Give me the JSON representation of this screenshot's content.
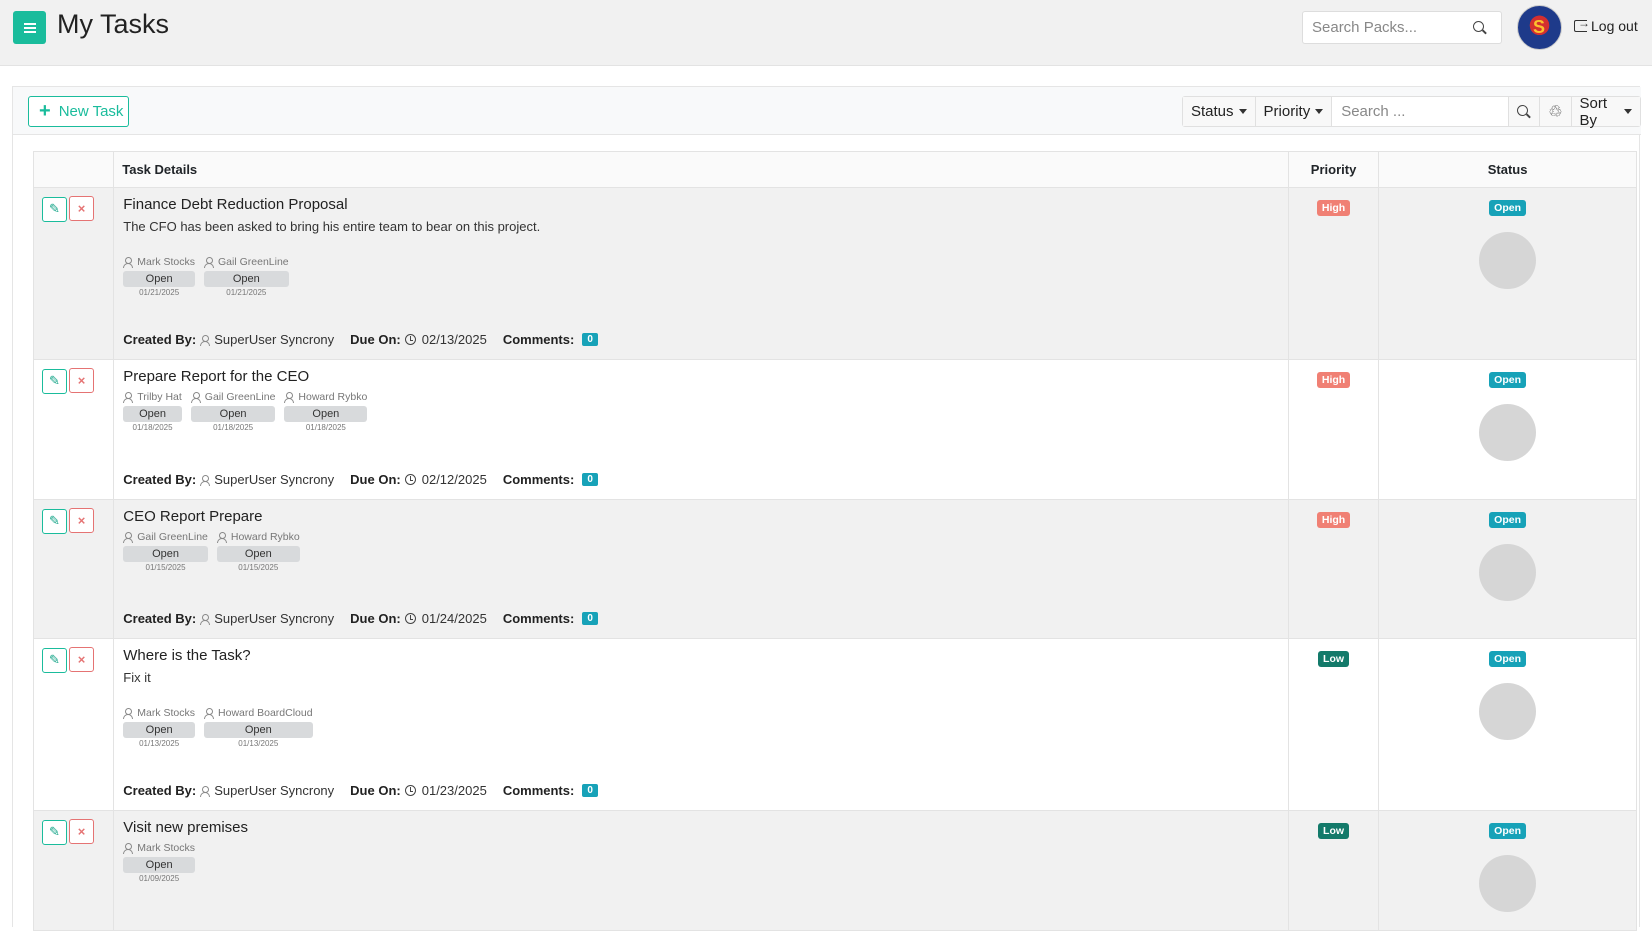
{
  "header": {
    "title": "My Tasks",
    "search_placeholder": "Search Packs...",
    "logout_label": "Log out"
  },
  "toolbar": {
    "new_task_label": "New Task",
    "status_label": "Status",
    "priority_label": "Priority",
    "search_placeholder": "Search ...",
    "sort_label": "Sort By"
  },
  "table": {
    "headers": {
      "details": "Task Details",
      "priority": "Priority",
      "status": "Status"
    },
    "labels": {
      "created_by": "Created By:",
      "due_on": "Due On:",
      "comments": "Comments:"
    },
    "rows": [
      {
        "title": "Finance Debt Reduction Proposal",
        "description": "The CFO has been asked to bring his entire team to bear on this project.",
        "assignees": [
          {
            "name": "Mark Stocks",
            "status": "Open",
            "date": "01/21/2025"
          },
          {
            "name": "Gail GreenLine",
            "status": "Open",
            "date": "01/21/2025"
          }
        ],
        "created_by": "SuperUser Syncrony",
        "due": "02/13/2025",
        "comments": "0",
        "priority": "High",
        "status": "Open"
      },
      {
        "title": "Prepare Report for the CEO",
        "description": "",
        "assignees": [
          {
            "name": "Trilby Hat",
            "status": "Open",
            "date": "01/18/2025"
          },
          {
            "name": "Gail GreenLine",
            "status": "Open",
            "date": "01/18/2025"
          },
          {
            "name": "Howard Rybko",
            "status": "Open",
            "date": "01/18/2025"
          }
        ],
        "created_by": "SuperUser Syncrony",
        "due": "02/12/2025",
        "comments": "0",
        "priority": "High",
        "status": "Open"
      },
      {
        "title": "CEO Report Prepare",
        "description": "",
        "assignees": [
          {
            "name": "Gail GreenLine",
            "status": "Open",
            "date": "01/15/2025"
          },
          {
            "name": "Howard Rybko",
            "status": "Open",
            "date": "01/15/2025"
          }
        ],
        "created_by": "SuperUser Syncrony",
        "due": "01/24/2025",
        "comments": "0",
        "priority": "High",
        "status": "Open"
      },
      {
        "title": "Where is the Task?",
        "description": "Fix it",
        "assignees": [
          {
            "name": "Mark Stocks",
            "status": "Open",
            "date": "01/13/2025"
          },
          {
            "name": "Howard BoardCloud",
            "status": "Open",
            "date": "01/13/2025"
          }
        ],
        "created_by": "SuperUser Syncrony",
        "due": "01/23/2025",
        "comments": "0",
        "priority": "Low",
        "status": "Open"
      },
      {
        "title": "Visit new premises",
        "description": "",
        "assignees": [
          {
            "name": "Mark Stocks",
            "status": "Open",
            "date": "01/09/2025"
          }
        ],
        "created_by": "",
        "due": "",
        "comments": "",
        "priority": "Low",
        "status": "Open"
      }
    ]
  },
  "colors": {
    "accent": "#1abc9c",
    "high": "#f08074",
    "low": "#137a6a",
    "open": "#17a2b8"
  }
}
